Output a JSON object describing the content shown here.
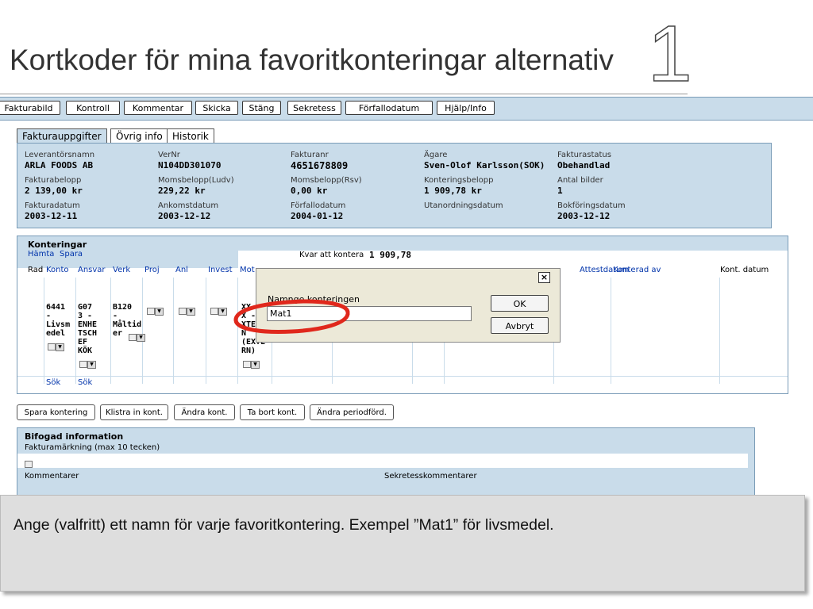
{
  "slide": {
    "title": "Kortkoder för mina favoritkonteringar alternativ",
    "number": "1",
    "caption": "Ange (valfritt) ett namn för varje favoritkontering. Exempel ”Mat1” för livsmedel."
  },
  "toolbar": [
    "Fakturabild",
    "Kontroll",
    "Kommentar",
    "Skicka",
    "Stäng",
    "Sekretess",
    "Förfallodatum",
    "Hjälp/Info"
  ],
  "tabs": [
    "Fakturauppgifter",
    "Övrig info",
    "Historik"
  ],
  "invoice": {
    "leverantorsnamn": {
      "label": "Leverantörsnamn",
      "value": "ARLA FOODS AB"
    },
    "vernr": {
      "label": "VerNr",
      "value": "N104DD301070"
    },
    "fakturanr": {
      "label": "Fakturanr",
      "value": "4651678809"
    },
    "agare": {
      "label": "Ägare",
      "value": "Sven-Olof Karlsson(SOK)"
    },
    "fakturastatus": {
      "label": "Fakturastatus",
      "value": "Obehandlad"
    },
    "fakturabelopp": {
      "label": "Fakturabelopp",
      "value": "2 139,00 kr"
    },
    "momsbelopp_ludv": {
      "label": "Momsbelopp(Ludv)",
      "value": "229,22 kr"
    },
    "momsbelopp_rsv": {
      "label": "Momsbelopp(Rsv)",
      "value": "0,00 kr"
    },
    "konteringsbelopp": {
      "label": "Konteringsbelopp",
      "value": "1 909,78 kr"
    },
    "antal_bilder": {
      "label": "Antal bilder",
      "value": "1"
    },
    "fakturadatum": {
      "label": "Fakturadatum",
      "value": "2003-12-11"
    },
    "ankomstdatum": {
      "label": "Ankomstdatum",
      "value": "2003-12-12"
    },
    "forfallodatum": {
      "label": "Förfallodatum",
      "value": "2004-01-12"
    },
    "utanordningsdatum": {
      "label": "Utanordningsdatum",
      "value": ""
    },
    "bokforingsdatum": {
      "label": "Bokföringsdatum",
      "value": "2003-12-12"
    }
  },
  "konteringar": {
    "title": "Konteringar",
    "hamta": "Hämta",
    "spara": "Spara",
    "kvar_label": "Kvar att kontera",
    "kvar_value": "1 909,78",
    "columns": [
      "Rad",
      "Konto",
      "Ansvar",
      "Verk",
      "Proj",
      "Anl",
      "Invest",
      "Mot",
      "Attestdatum",
      "Konterad av",
      "Kont. datum"
    ],
    "row": {
      "konto": "6441\n-\nLivsm\nedel",
      "ansvar": "G07\n3 -\nENHE\nTSCH\nEF\nKÖK",
      "verk": "B120\n-\nMåltid\ner",
      "mot": "XX\nX -\nXTE\nN\n(EXTE\nRN)"
    },
    "sok1": "Sök",
    "sok2": "Sök"
  },
  "action_buttons": [
    "Spara kontering",
    "Klistra in kont.",
    "Ändra kont.",
    "Ta bort kont.",
    "Ändra periodförd."
  ],
  "bifogad": {
    "title": "Bifogad information",
    "fakturamarkning_label": "Fakturamärkning (max 10 tecken)",
    "kommentarer_label": "Kommentarer",
    "sekretess_label": "Sekretesskommentarer"
  },
  "dialog": {
    "label": "Namnge konteringen",
    "input_value": "Mat1",
    "ok": "OK",
    "cancel": "Avbryt",
    "close": "×"
  },
  "colors": {
    "panel": "#c9dcea",
    "annotation": "#e0281c",
    "link": "#0033aa"
  }
}
